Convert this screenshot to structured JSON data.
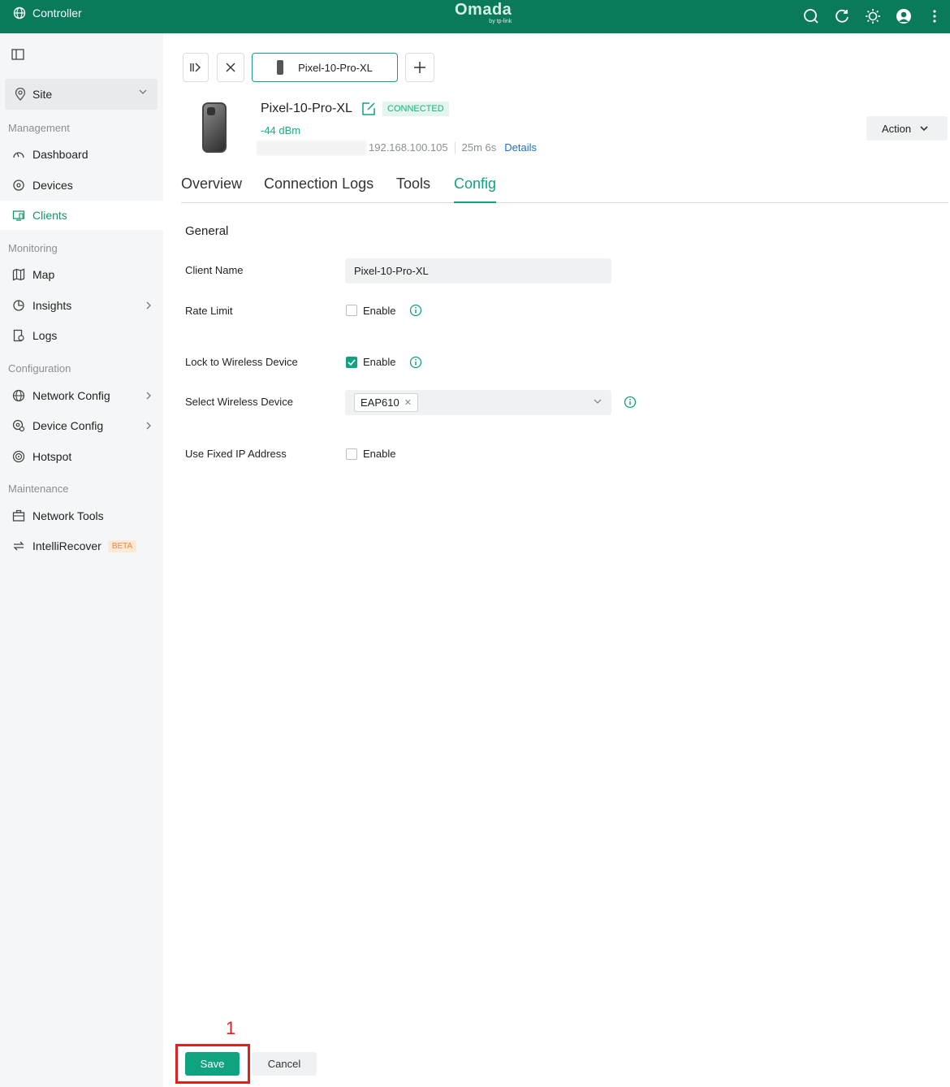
{
  "topbar": {
    "app_title": "Controller",
    "logo_text": "Omada",
    "logo_sub": "by tp-link",
    "icons": [
      "search-icon",
      "refresh-icon",
      "theme-icon",
      "avatar",
      "more-icon"
    ]
  },
  "sidebar": {
    "site_label": "Site",
    "sections": {
      "management": "Management",
      "monitoring": "Monitoring",
      "configuration": "Configuration",
      "maintenance": "Maintenance"
    },
    "items": {
      "dashboard": "Dashboard",
      "devices": "Devices",
      "clients": "Clients",
      "map": "Map",
      "insights": "Insights",
      "logs": "Logs",
      "network_config": "Network Config",
      "device_config": "Device Config",
      "hotspot": "Hotspot",
      "network_tools": "Network Tools",
      "intellirecover": "IntelliRecover",
      "beta": "BETA"
    }
  },
  "client": {
    "tab_label": "Pixel-10-Pro-XL",
    "name": "Pixel-10-Pro-XL",
    "status": "CONNECTED",
    "signal": "-44 dBm",
    "ip": "192.168.100.105",
    "uptime": "25m 6s",
    "details_link": "Details",
    "action_label": "Action"
  },
  "tabs": {
    "overview": "Overview",
    "connection_logs": "Connection Logs",
    "tools": "Tools",
    "config": "Config"
  },
  "form": {
    "section_title": "General",
    "client_name_label": "Client Name",
    "client_name_value": "Pixel-10-Pro-XL",
    "rate_limit_label": "Rate Limit",
    "rate_limit_enable": "Enable",
    "rate_limit_checked": false,
    "lock_label": "Lock to Wireless Device",
    "lock_enable": "Enable",
    "lock_checked": true,
    "select_device_label": "Select Wireless Device",
    "selected_device": "EAP610",
    "fixed_ip_label": "Use Fixed IP Address",
    "fixed_ip_enable": "Enable",
    "fixed_ip_checked": false
  },
  "footer": {
    "annotation_number": "1",
    "save_label": "Save",
    "cancel_label": "Cancel"
  },
  "colors": {
    "brand": "#0a7a5b",
    "accent": "#10a37f",
    "annotation": "#e02020",
    "link": "#1a6fd6"
  }
}
